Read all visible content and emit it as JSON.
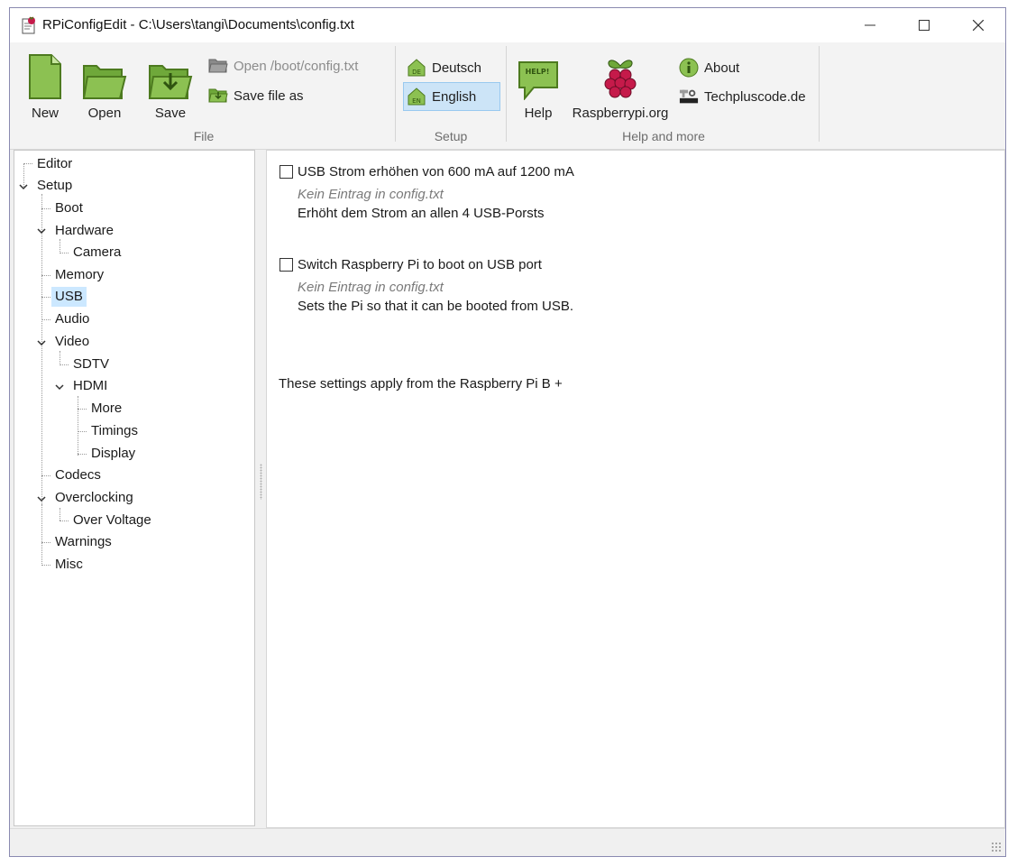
{
  "window": {
    "title": "RPiConfigEdit - C:\\Users\\tangi\\Documents\\config.txt"
  },
  "ribbon": {
    "file_group": {
      "label": "File",
      "new_label": "New",
      "open_label": "Open",
      "save_label": "Save",
      "open_boot_label": "Open /boot/config.txt",
      "save_as_label": "Save file as"
    },
    "setup_group": {
      "label": "Setup",
      "deutsch_label": "Deutsch",
      "english_label": "English",
      "de_icon_text": "DE",
      "en_icon_text": "EN"
    },
    "help_group": {
      "label": "Help and more",
      "help_label": "Help",
      "help_icon_text": "HELP!",
      "raspberry_label": "Raspberrypi.org",
      "about_label": "About",
      "techplus_label": "Techpluscode.de"
    }
  },
  "tree": {
    "items": [
      {
        "label": "Editor"
      },
      {
        "label": "Setup"
      },
      {
        "label": "Boot"
      },
      {
        "label": "Hardware"
      },
      {
        "label": "Camera"
      },
      {
        "label": "Memory"
      },
      {
        "label": "USB"
      },
      {
        "label": "Audio"
      },
      {
        "label": "Video"
      },
      {
        "label": "SDTV"
      },
      {
        "label": "HDMI"
      },
      {
        "label": "More"
      },
      {
        "label": "Timings"
      },
      {
        "label": "Display"
      },
      {
        "label": "Codecs"
      },
      {
        "label": "Overclocking"
      },
      {
        "label": "Over Voltage"
      },
      {
        "label": "Warnings"
      },
      {
        "label": "Misc"
      }
    ],
    "selected": "USB"
  },
  "content": {
    "options": [
      {
        "label": "USB Strom erhöhen von 600 mA auf 1200 mA",
        "status": "Kein Eintrag in config.txt",
        "description": "Erhöht dem Strom an allen 4 USB-Porsts"
      },
      {
        "label": "Switch Raspberry Pi to boot on USB port",
        "status": "Kein Eintrag in config.txt",
        "description": "Sets the Pi so that it can be booted from USB."
      }
    ],
    "note": "These settings apply from the Raspberry Pi B +"
  },
  "colors": {
    "icon_green": "#8cc152",
    "icon_green_dark": "#4d7a1f",
    "selection": "#cce8ff",
    "raspberry_red": "#c51a4a"
  }
}
